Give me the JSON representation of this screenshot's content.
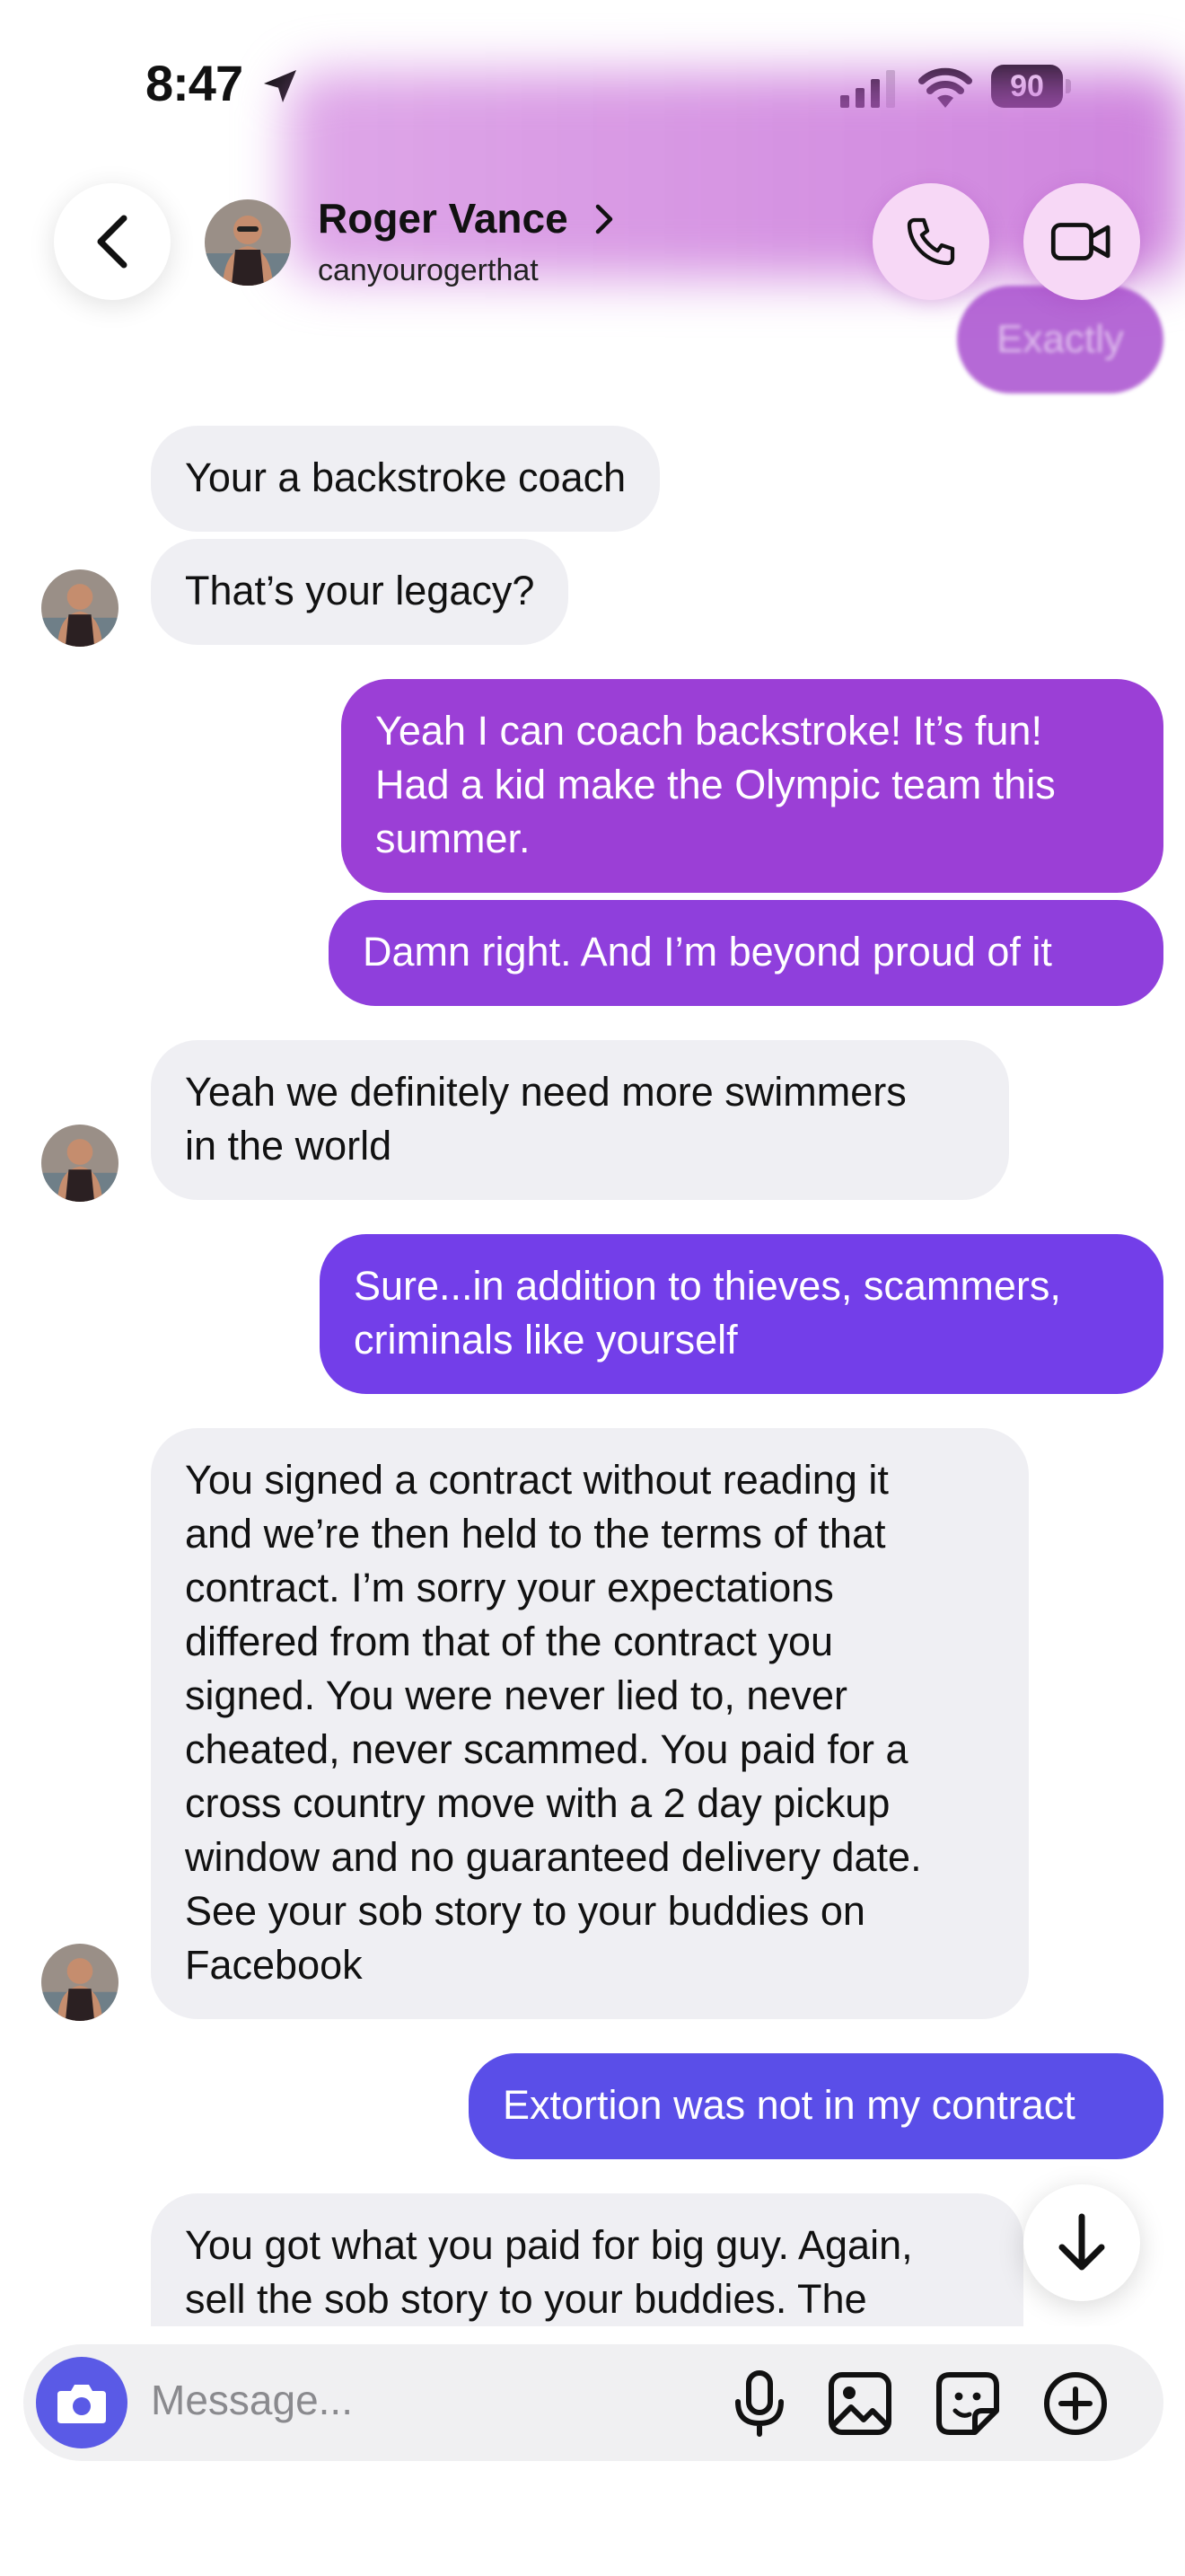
{
  "status_bar": {
    "time": "8:47",
    "battery": "90"
  },
  "header": {
    "name": "Roger Vance",
    "username": "canyourogerthat",
    "partial_bubble": "Exactly"
  },
  "messages": [
    {
      "side": "in",
      "text": "Your a backstroke coach"
    },
    {
      "side": "in",
      "text": "That’s your legacy?"
    },
    {
      "side": "out",
      "text": "Yeah I can coach backstroke!  It’s fun!\nHad a kid make the Olympic team this\nsummer."
    },
    {
      "side": "out",
      "text": "Damn right.  And I’m beyond proud of it"
    },
    {
      "side": "in",
      "text": "Yeah we definitely need more swimmers\nin the world"
    },
    {
      "side": "out",
      "text": "Sure...in addition to thieves, scammers,\ncriminals like yourself"
    },
    {
      "side": "in",
      "text": "You signed a contract without reading it\nand we’re then held to the terms of that\ncontract. I’m sorry your expectations\ndiffered from that of the contract you\nsigned. You were never lied to, never\ncheated, never scammed. You paid for a\ncross country move with a 2 day pickup\nwindow and no guaranteed delivery date.\nSee your sob story to your buddies on\nFacebook"
    },
    {
      "side": "out",
      "text": "Extortion was not in my contract"
    },
    {
      "side": "in",
      "text": "You got what you paid for big guy. Again,\nsell the sob story to your buddies. The\nDOT and every judge in the United"
    }
  ],
  "composer": {
    "placeholder": "Message..."
  },
  "colors": {
    "outgoing_top": "#9b3fd6",
    "outgoing_mid": "#7a3ee8",
    "outgoing_bottom": "#5a4ee8",
    "incoming": "#efeff3",
    "camera_button": "#5a5ae6",
    "call_button_bg": "#f7d8f6"
  },
  "icons": [
    "location-arrow-icon",
    "signal-icon",
    "wifi-icon",
    "battery-icon",
    "back-icon",
    "chevron-right-icon",
    "phone-icon",
    "video-icon",
    "arrow-down-icon",
    "camera-icon",
    "microphone-icon",
    "image-icon",
    "sticker-icon",
    "plus-icon"
  ]
}
